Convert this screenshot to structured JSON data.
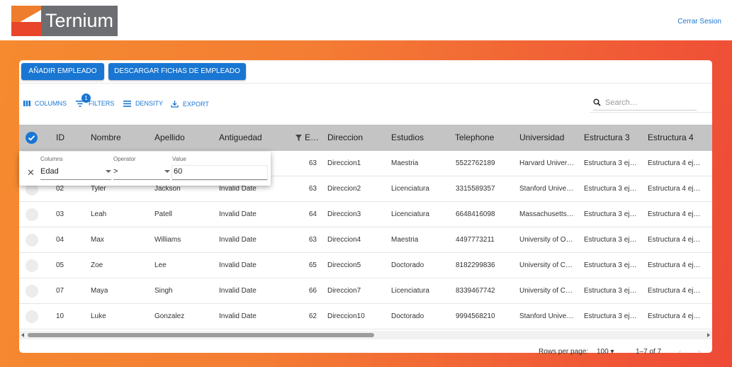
{
  "brand": {
    "logo_text": "Ternium",
    "logout": "Cerrar Sesion"
  },
  "colors": {
    "accent": "#1976d2",
    "bg_orange": "#f47d34",
    "bg_red": "#ee4a36"
  },
  "actions": {
    "add_employee": "AÑADIR EMPLEADO",
    "download_sheets": "DESCARGAR FICHAS DE EMPLEADO"
  },
  "toolbar": {
    "columns": "COLUMNS",
    "filters": "FILTERS",
    "filter_count": "1",
    "density": "DENSITY",
    "export": "EXPORT",
    "search_placeholder": "Search…"
  },
  "table": {
    "headers": {
      "id": "ID",
      "nombre": "Nombre",
      "apellido": "Apellido",
      "antiguedad": "Antiguedad",
      "edad": "E…",
      "direccion": "Direccion",
      "estudios": "Estudios",
      "telephone": "Telephone",
      "universidad": "Universidad",
      "estructura3": "Estructura 3",
      "estructura4": "Estructura 4"
    },
    "rows": [
      {
        "id": "",
        "nombre": "",
        "apellido": "",
        "antiguedad": "",
        "edad": "63",
        "direccion": "Direccion1",
        "estudios": "Maestria",
        "telephone": "5522762189",
        "universidad": "Harvard Univer…",
        "e3": "Estructura 3 ej…",
        "e4": "Estructura 4 ej…"
      },
      {
        "id": "02",
        "nombre": "Tyler",
        "apellido": "Jackson",
        "antiguedad": "Invalid Date",
        "edad": "63",
        "direccion": "Direccion2",
        "estudios": "Licenciatura",
        "telephone": "3315589357",
        "universidad": "Stanford Unive…",
        "e3": "Estructura 3 ej…",
        "e4": "Estructura 4 ej…"
      },
      {
        "id": "03",
        "nombre": "Leah",
        "apellido": "Patell",
        "antiguedad": "Invalid Date",
        "edad": "64",
        "direccion": "Direccion3",
        "estudios": "Licenciatura",
        "telephone": "6648416098",
        "universidad": "Massachusetts…",
        "e3": "Estructura 3 ej…",
        "e4": "Estructura 4 ej…"
      },
      {
        "id": "04",
        "nombre": "Max",
        "apellido": "Williams",
        "antiguedad": "Invalid Date",
        "edad": "63",
        "direccion": "Direccion4",
        "estudios": "Maestria",
        "telephone": "4497773211",
        "universidad": "University of O…",
        "e3": "Estructura 3 ej…",
        "e4": "Estructura 4 ej…"
      },
      {
        "id": "05",
        "nombre": "Zoe",
        "apellido": "Lee",
        "antiguedad": "Invalid Date",
        "edad": "65",
        "direccion": "Direccion5",
        "estudios": "Doctorado",
        "telephone": "8182299836",
        "universidad": "University of C…",
        "e3": "Estructura 3 ej…",
        "e4": "Estructura 4 ej…"
      },
      {
        "id": "07",
        "nombre": "Maya",
        "apellido": "Singh",
        "antiguedad": "Invalid Date",
        "edad": "66",
        "direccion": "Direccion7",
        "estudios": "Licenciatura",
        "telephone": "8339467742",
        "universidad": "University of C…",
        "e3": "Estructura 3 ej…",
        "e4": "Estructura 4 ej…"
      },
      {
        "id": "10",
        "nombre": "Luke",
        "apellido": "Gonzalez",
        "antiguedad": "Invalid Date",
        "edad": "62",
        "direccion": "Direccion10",
        "estudios": "Doctorado",
        "telephone": "9994568210",
        "universidad": "Stanford Unive…",
        "e3": "Estructura 3 ej…",
        "e4": "Estructura 4 ej…"
      }
    ]
  },
  "filter_panel": {
    "columns_label": "Columns",
    "operator_label": "Operator",
    "value_label": "Value",
    "column": "Edad",
    "operator": ">",
    "value": "60"
  },
  "footer": {
    "rows_per_page_label": "Rows per page:",
    "rows_per_page": "100",
    "range": "1–7 of 7"
  }
}
